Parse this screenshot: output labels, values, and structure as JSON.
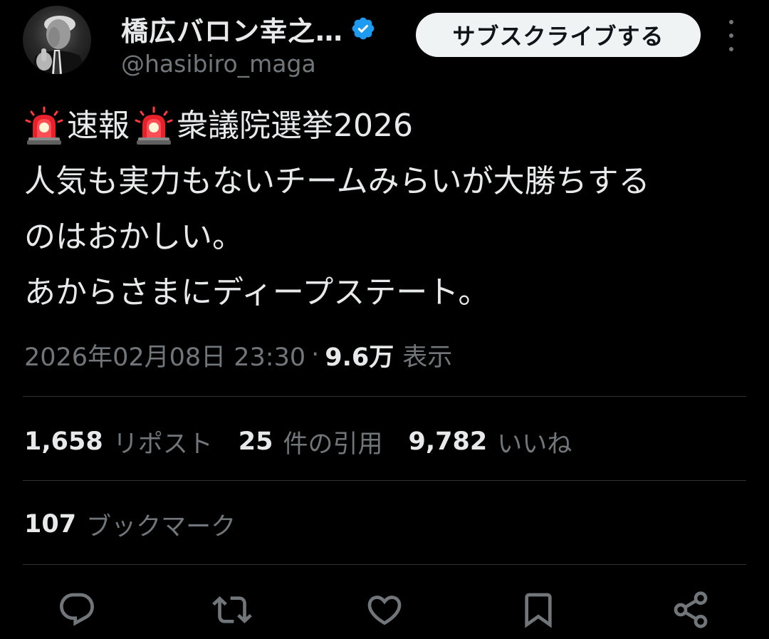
{
  "header": {
    "display_name": "橋広バロン幸之…",
    "handle": "@hasibiro_maga",
    "subscribe_label": "サブスクライブする",
    "avatar_icon": "user-avatar",
    "verified_icon": "verified-badge-icon",
    "more_icon": "more-vertical-icon"
  },
  "tweet": {
    "line1_part1": "速報",
    "line1_part2": "衆議院選挙2026",
    "line2": "人気も実力もないチームみらいが大勝ちする",
    "line3": "のはおかしい。",
    "line4": "あからさまにディープステート。",
    "emoji_icon": "rotating-light-icon"
  },
  "meta": {
    "timestamp": "2026年02月08日 23:30",
    "separator": "·",
    "views_count": "9.6万",
    "views_label": "表示"
  },
  "stats": {
    "reposts_count": "1,658",
    "reposts_label": "リポスト",
    "quotes_count": "25",
    "quotes_label": "件の引用",
    "likes_count": "9,782",
    "likes_label": "いいね",
    "bookmarks_count": "107",
    "bookmarks_label": "ブックマーク"
  },
  "actions": [
    {
      "icon": "reply-icon"
    },
    {
      "icon": "repost-icon"
    },
    {
      "icon": "like-icon"
    },
    {
      "icon": "bookmark-icon"
    },
    {
      "icon": "share-icon"
    }
  ],
  "colors": {
    "background": "#000000",
    "primary_text": "#e7e9ea",
    "secondary_text": "#71767b",
    "divider": "#2f3336",
    "verified": "#1d9bf0",
    "subscribe_bg": "#eff3f4"
  }
}
